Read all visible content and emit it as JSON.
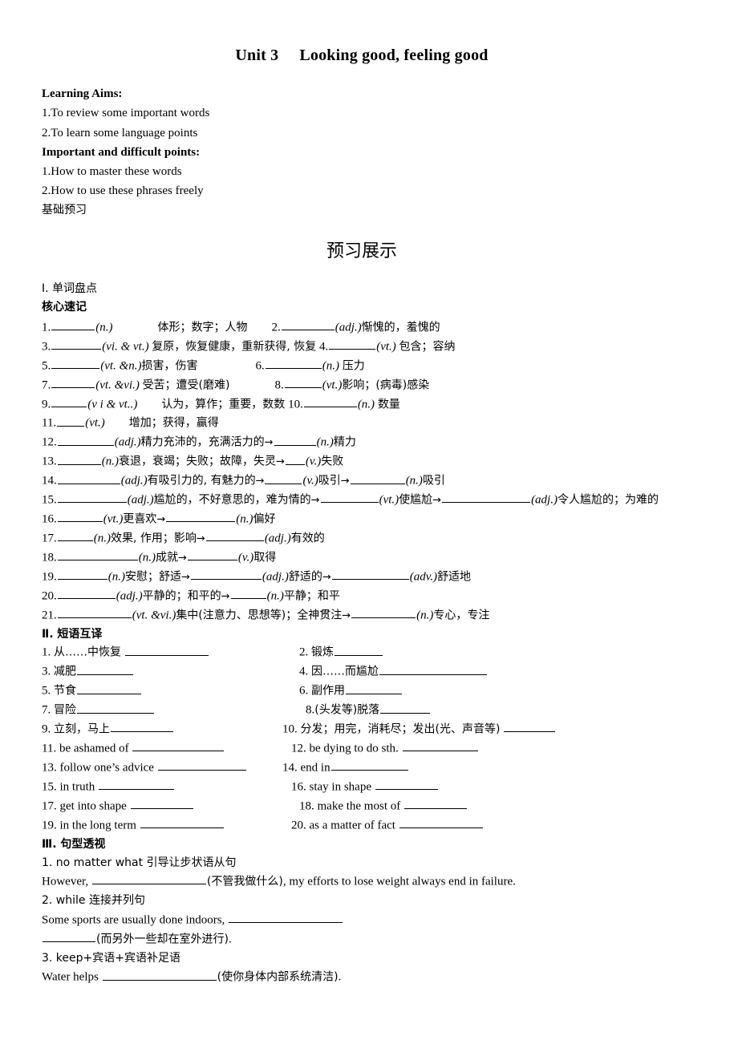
{
  "document": {
    "title_unit": "Unit 3",
    "title_main": "Looking good, feeling good",
    "learning_aims_label": "Learning Aims:",
    "learning_aims": [
      "1.To review some important words",
      "2.To learn some language points"
    ],
    "important_points_label": "Important and difficult points:",
    "important_points": [
      "1.How to master these words",
      "2.How to use these phrases freely"
    ],
    "basic_preview_label": "基础预习",
    "preview_heading": "预习展示"
  },
  "section_words": {
    "heading": "Ⅰ. 单词盘点",
    "subheading": "核心速记",
    "items": [
      {
        "num": "1.",
        "pos": "(n.)",
        "meaning": "体形；数字；人物"
      },
      {
        "num": "2.",
        "pos": "(adj.)",
        "meaning": "惭愧的，羞愧的"
      },
      {
        "num": "3.",
        "pos": "(vi. & vt.)",
        "meaning": "复原，恢复健康，重新获得, 恢复"
      },
      {
        "num": "4.",
        "pos": "(vt.)",
        "meaning": "包含；容纳"
      },
      {
        "num": "5.",
        "pos": "(vt. &n.)",
        "meaning": "损害，伤害"
      },
      {
        "num": "6.",
        "pos": "(n.)",
        "meaning": "压力"
      },
      {
        "num": "7.",
        "pos": "(vt. &vi.)",
        "meaning": "受苦；遭受(磨难)"
      },
      {
        "num": "8.",
        "pos": "(vt.)",
        "meaning": "影响；(病毒)感染"
      },
      {
        "num": "9.",
        "pos": "(v i & vt..)",
        "meaning": "认为，算作；重要，数数"
      },
      {
        "num": "10.",
        "pos": "(n.)",
        "meaning": "数量"
      },
      {
        "num": "11.",
        "pos": "(vt.)",
        "meaning": "增加；获得，赢得"
      },
      {
        "num": "12.",
        "pos": "(adj.)",
        "meaning": "精力充沛的，充满活力的",
        "pos2": "(n.)",
        "meaning2": "精力"
      },
      {
        "num": "13.",
        "pos": "(n.)",
        "meaning": "衰退，衰竭；失败；故障，失灵",
        "pos2": "(v.)",
        "meaning2": "失败"
      },
      {
        "num": "14.",
        "pos": "(adj.)",
        "meaning": "有吸引力的, 有魅力的",
        "pos2": "(v.)",
        "meaning2": "吸引",
        "pos3": "(n.)",
        "meaning3": "吸引"
      },
      {
        "num": "15.",
        "pos": "(adj.)",
        "meaning": "尴尬的，不好意思的，难为情的",
        "pos2": "(vt.)",
        "meaning2": "使尴尬",
        "pos3": "(adj.)",
        "meaning3": "令人尴尬的；",
        "meaning3_cont": "为难的"
      },
      {
        "num": "16.",
        "pos": "(vt.)",
        "meaning": "更喜欢",
        "pos2": "(n.)",
        "meaning2": "偏好"
      },
      {
        "num": "17.",
        "pos": "(n.)",
        "meaning": "效果, 作用；影响",
        "pos2": "(adj.)",
        "meaning2": "有效的"
      },
      {
        "num": "18.",
        "pos": "(n.)",
        "meaning": "成就",
        "pos2": "(v.)",
        "meaning2": "取得"
      },
      {
        "num": "19.",
        "pos": "(n.)",
        "meaning": "安慰；舒适",
        "pos2": "(adj.)",
        "meaning2": "舒适的",
        "pos3": "(adv.)",
        "meaning3": "舒适地"
      },
      {
        "num": "20.",
        "pos": "(adj.)",
        "meaning": "平静的；和平的",
        "pos2": "(n.)",
        "meaning2": "平静；和平"
      },
      {
        "num": "21.",
        "pos": "(vt. &vi.)",
        "meaning": "集中(注意力、思想等)；全神贯注",
        "pos2": "(n.)",
        "meaning2": "专心，专注"
      }
    ]
  },
  "section_phrases": {
    "heading": "Ⅱ. 短语互译",
    "items": [
      {
        "num": "1.",
        "text": "从……中恢复"
      },
      {
        "num": "2.",
        "text": "锻炼"
      },
      {
        "num": "3.",
        "text": "减肥"
      },
      {
        "num": "4.",
        "text": "因……而尴尬"
      },
      {
        "num": "5.",
        "text": "节食"
      },
      {
        "num": "6.",
        "text": "副作用"
      },
      {
        "num": "7.",
        "text": "冒险"
      },
      {
        "num": "8.",
        "text": "(头发等)脱落"
      },
      {
        "num": "9.",
        "text": "立刻，马上"
      },
      {
        "num": "10.",
        "text": "分发；用完，消耗尽；发出(光、声音等)"
      },
      {
        "num": "11.",
        "text": "be ashamed of"
      },
      {
        "num": "12.",
        "text": "be dying to do sth."
      },
      {
        "num": "13.",
        "text": "follow one’s advice"
      },
      {
        "num": "14.",
        "text": "end in"
      },
      {
        "num": "15.",
        "text": "in truth"
      },
      {
        "num": "16.",
        "text": "stay in shape"
      },
      {
        "num": "17.",
        "text": "get into shape"
      },
      {
        "num": "18.",
        "text": "make the most of"
      },
      {
        "num": "19.",
        "text": "in the long term"
      },
      {
        "num": "20.",
        "text": "as a matter of fact"
      }
    ]
  },
  "section_sentences": {
    "heading": "Ⅲ. 句型透视",
    "items": [
      {
        "title": "1. no matter what 引导让步状语从句",
        "pre": "However, ",
        "hint": "(不管我做什么)",
        "post": ", my efforts to lose weight always end in failure."
      },
      {
        "title": "2. while 连接并列句",
        "pre": "Some sports are usually done indoors, ",
        "hint": "(而另外一些却在室外进行)",
        "post": "."
      },
      {
        "title": "3. keep+宾语+宾语补足语",
        "pre": "Water helps ",
        "hint": "(使你身体内部系统清洁)",
        "post": "."
      }
    ]
  }
}
